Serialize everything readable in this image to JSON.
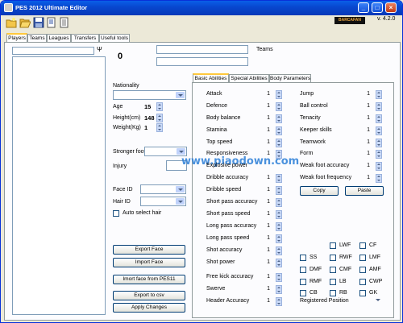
{
  "window": {
    "title": "PES 2012 Ultimate Editor",
    "version": "v. 4.2.0",
    "logo_text": "BARCAFAN"
  },
  "toolbar": {
    "icons": [
      "new-folder-icon",
      "open-folder-icon",
      "save-icon",
      "save-as-icon",
      "export-icon"
    ]
  },
  "main_tabs": [
    "Players",
    "Teams",
    "Leagues",
    "Transfers",
    "Useful tools"
  ],
  "filter_icon": "Ψ",
  "player": {
    "id": "0",
    "teams_label": "Teams"
  },
  "left": {
    "nationality_label": "Nationality",
    "age_label": "Age",
    "age_value": "15",
    "height_label": "Height(cm)",
    "height_value": "148",
    "weight_label": "Weight(Kg)",
    "weight_value": "1",
    "stronger_foot_label": "Stronger foot",
    "injury_label": "Injury",
    "face_id_label": "Face ID",
    "hair_id_label": "Hair ID",
    "auto_hair_label": "Auto select hair",
    "buttons": [
      "Export Face",
      "Import Face",
      "Imort face from PES11",
      "Export to csv",
      "Apply Changes"
    ]
  },
  "sub_tabs": [
    "Basic Abilities",
    "Special Abilities",
    "Body Parameters"
  ],
  "abilities_left": [
    {
      "label": "Attack",
      "value": "1"
    },
    {
      "label": "Defence",
      "value": "1"
    },
    {
      "label": "Body balance",
      "value": "1"
    },
    {
      "label": "Stamina",
      "value": "1"
    },
    {
      "label": "Top speed",
      "value": "1"
    },
    {
      "label": "Responsiveness",
      "value": "1"
    },
    {
      "label": "Explosive power",
      "value": ""
    },
    {
      "label": "Dribble accuracy",
      "value": "1"
    },
    {
      "label": "Dribble speed",
      "value": "1"
    },
    {
      "label": "Short pass accuracy",
      "value": "1"
    },
    {
      "label": "Short pass speed",
      "value": "1"
    },
    {
      "label": "Long pass accuracy",
      "value": "1"
    },
    {
      "label": "Long pass speed",
      "value": "1"
    },
    {
      "label": "Shot accuracy",
      "value": "1"
    },
    {
      "label": "Shot power",
      "value": "1"
    },
    {
      "label": "Free kick accuracy",
      "value": "1"
    },
    {
      "label": "Swerve",
      "value": "1"
    },
    {
      "label": "Header Accuracy",
      "value": "1"
    }
  ],
  "abilities_right": [
    {
      "label": "Jump",
      "value": "1"
    },
    {
      "label": "Ball control",
      "value": "1"
    },
    {
      "label": "Tenacity",
      "value": "1"
    },
    {
      "label": "Keeper skills",
      "value": "1"
    },
    {
      "label": "Teamwork",
      "value": "1"
    },
    {
      "label": "Form",
      "value": "1"
    },
    {
      "label": "Weak foot accuracy",
      "value": "1"
    },
    {
      "label": "Weak foot frequency",
      "value": "1"
    }
  ],
  "copy_label": "Copy",
  "paste_label": "Paste",
  "positions": [
    [
      "",
      "LWF",
      "CF"
    ],
    [
      "SS",
      "RWF",
      "LMF"
    ],
    [
      "DMF",
      "CMF",
      "AMF"
    ],
    [
      "RMF",
      "LB",
      "CWP"
    ],
    [
      "CB",
      "RB",
      "GK"
    ]
  ],
  "registered_position_label": "Registered Position",
  "watermark": "www.piaodown.com"
}
